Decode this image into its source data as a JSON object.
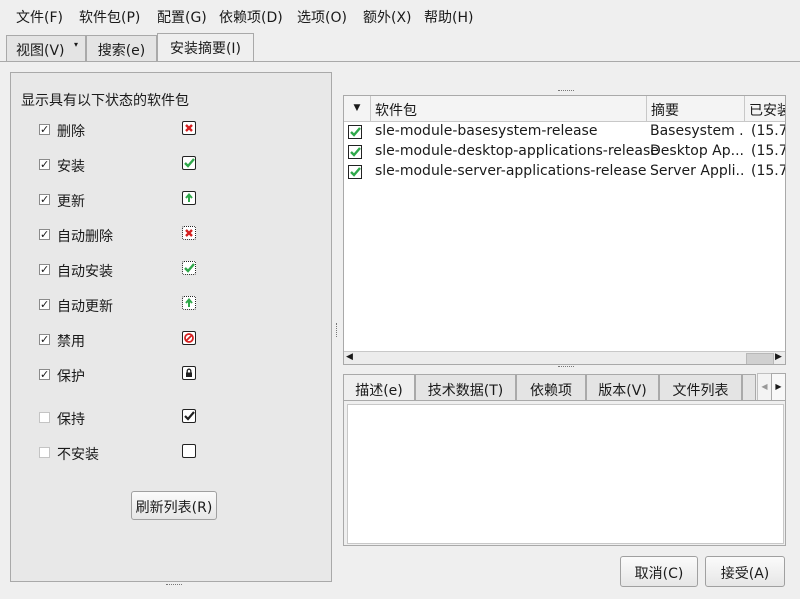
{
  "menubar": {
    "file": "文件(F)",
    "package": "软件包(P)",
    "config": "配置(G)",
    "deps": "依赖项(D)",
    "options": "选项(O)",
    "extras": "额外(X)",
    "help": "帮助(H)"
  },
  "view_tabs": {
    "view": "视图(V)",
    "search": "搜索(e)",
    "summary": "安装摘要(I)"
  },
  "filter": {
    "heading": "显示具有以下状态的软件包",
    "items": [
      {
        "label": "删除",
        "checked": "✓",
        "icon": "delete-status-icon"
      },
      {
        "label": "安装",
        "checked": "✓",
        "icon": "install-status-icon"
      },
      {
        "label": "更新",
        "checked": "✓",
        "icon": "update-status-icon"
      },
      {
        "label": "自动删除",
        "checked": "✓",
        "icon": "auto-delete-status-icon"
      },
      {
        "label": "自动安装",
        "checked": "✓",
        "icon": "auto-install-status-icon"
      },
      {
        "label": "自动更新",
        "checked": "✓",
        "icon": "auto-update-status-icon"
      },
      {
        "label": "禁用",
        "checked": "✓",
        "icon": "taboo-status-icon"
      },
      {
        "label": "保护",
        "checked": "✓",
        "icon": "protected-status-icon"
      },
      {
        "label": "保持",
        "checked": "",
        "icon": "keep-status-icon"
      },
      {
        "label": "不安装",
        "checked": "",
        "icon": "do-not-install-status-icon"
      }
    ],
    "refresh": "刷新列表(R)"
  },
  "table": {
    "headers": {
      "sort": "▼",
      "package": "软件包",
      "summary": "摘要",
      "installed": "已安装"
    },
    "rows": [
      {
        "name": "sle-module-basesystem-release",
        "summary": "Basesystem ...",
        "installed": "(15.7"
      },
      {
        "name": "sle-module-desktop-applications-release",
        "summary": "Desktop Ap...",
        "installed": "(15.7"
      },
      {
        "name": "sle-module-server-applications-release",
        "summary": "Server Appli...",
        "installed": "(15.7"
      }
    ]
  },
  "detail_tabs": {
    "description": "描述(e)",
    "technical": "技术数据(T)",
    "dependencies": "依赖项",
    "versions": "版本(V)",
    "files": "文件列表"
  },
  "buttons": {
    "cancel": "取消(C)",
    "accept": "接受(A)"
  },
  "colors": {
    "check_green": "#2fa84a",
    "delete_red": "#d42020"
  }
}
